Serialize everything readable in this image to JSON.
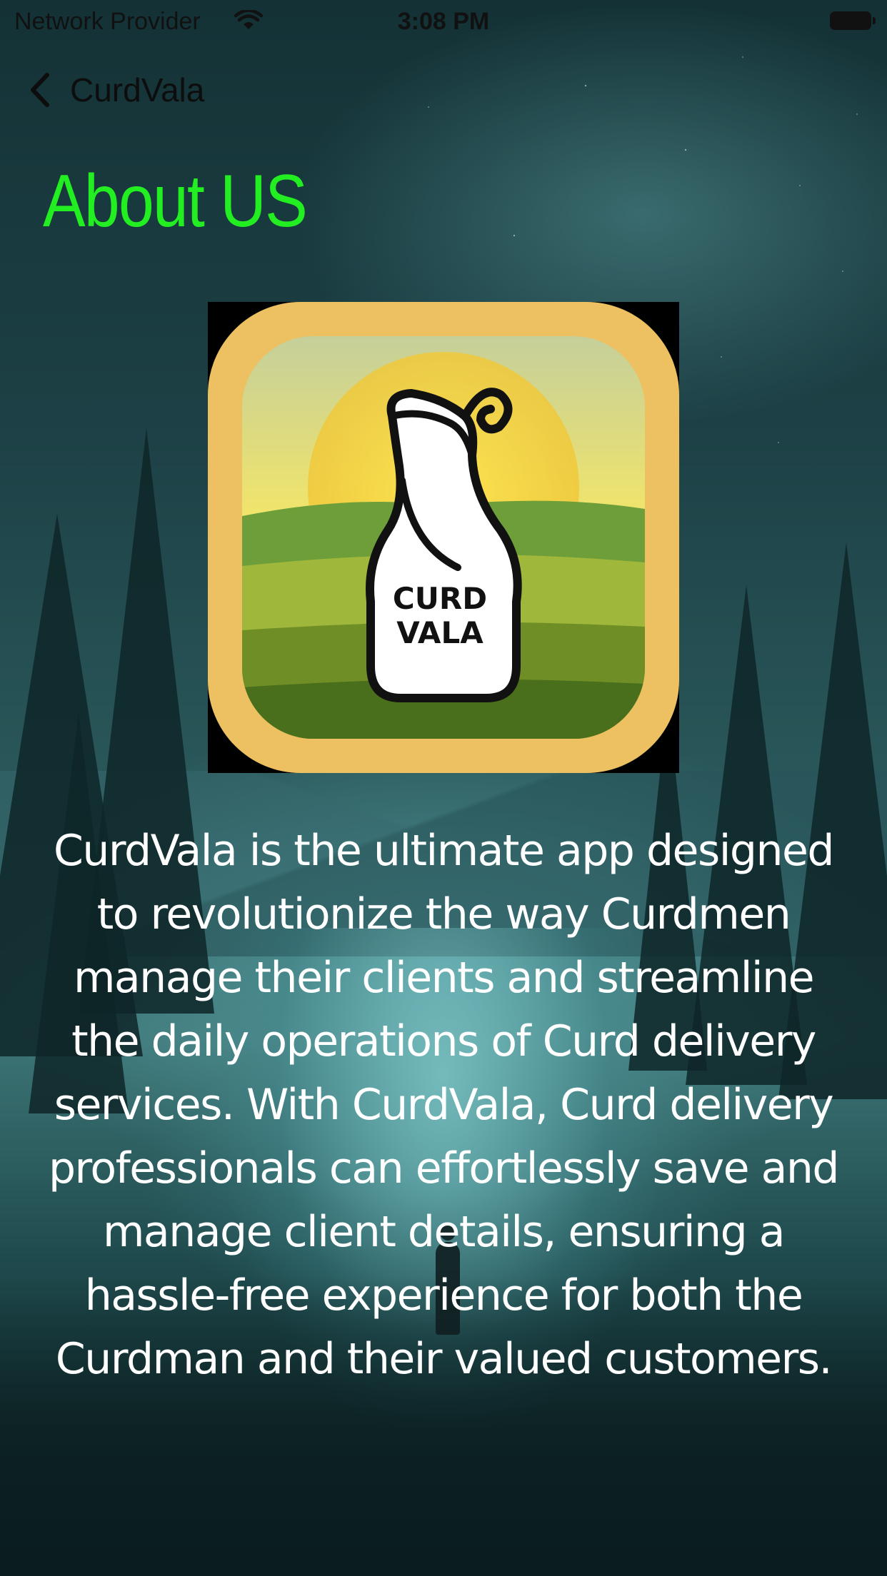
{
  "status_bar": {
    "provider": "Network Provider",
    "time": "3:08 PM",
    "wifi_icon": "wifi-icon",
    "battery_icon": "battery-icon"
  },
  "nav": {
    "back_icon": "chevron-left-icon",
    "back_label": "CurdVala"
  },
  "page": {
    "title": "About US",
    "title_color": "#22ee22"
  },
  "logo": {
    "line1": "CUR",
    "line1_ligature": "D",
    "line2": "VALA",
    "frame_color": "#edc061"
  },
  "about": {
    "description": "CurdVala is the ultimate app designed to revolutionize the way Curdmen manage their clients and streamline the daily operations of Curd delivery services. With CurdVala, Curd delivery professionals can effortlessly save and manage client details, ensuring a hassle-free experience for both the Curdman and their valued customers."
  }
}
